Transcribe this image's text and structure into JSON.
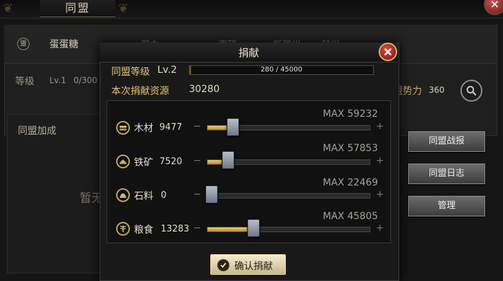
{
  "background": {
    "title_tab": "同盟",
    "alliance_name": "蛋蛋糖",
    "emblem_char": "盟",
    "tabs": [
      "盟主",
      "声望",
      "所属州",
      "赫州"
    ],
    "level_label": "等级",
    "level_value": "Lv.1",
    "level_progress": "0/300",
    "power_label": "盟势力",
    "power_value": "360",
    "bonus_label": "同盟加成",
    "empty_text": "暂无",
    "side_buttons": [
      "同盟战报",
      "同盟日志",
      "管理"
    ]
  },
  "dialog": {
    "title": "捐献",
    "alliance_level_label": "同盟等级",
    "alliance_level_value": "Lv.2",
    "exp": {
      "current": 280,
      "max": 45000,
      "text": "280 / 45000"
    },
    "donate_total_label": "本次捐献资源",
    "donate_total_value": "30280",
    "resources": [
      {
        "name": "木材",
        "icon": "wood-icon",
        "amount": "9477",
        "max_text": "MAX 59232",
        "max": 59232,
        "value": 9477
      },
      {
        "name": "铁矿",
        "icon": "iron-icon",
        "amount": "7520",
        "max_text": "MAX 57853",
        "max": 57853,
        "value": 7520
      },
      {
        "name": "石料",
        "icon": "stone-icon",
        "amount": "0",
        "max_text": "MAX 22469",
        "max": 22469,
        "value": 0
      },
      {
        "name": "粮食",
        "icon": "grain-icon",
        "amount": "13283",
        "max_text": "MAX 45805",
        "max": 45805,
        "value": 13283
      }
    ],
    "minus_glyph": "−",
    "plus_glyph": "+",
    "confirm_label": "确认捐献"
  },
  "colors": {
    "gold_label": "#e3c37a",
    "slider_fill": "#e0b856",
    "close_red": "#c53a2e"
  }
}
